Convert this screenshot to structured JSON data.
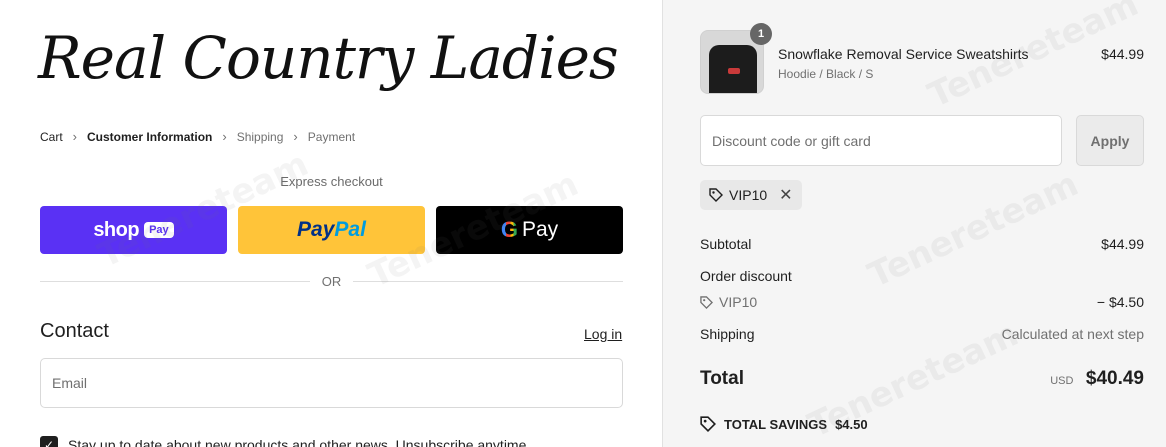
{
  "brand": {
    "logo_text": "Real Country Ladies"
  },
  "breadcrumb": {
    "items": [
      "Cart",
      "Customer Information",
      "Shipping",
      "Payment"
    ],
    "separator": "›"
  },
  "express": {
    "title": "Express checkout",
    "shop_word": "shop",
    "shop_pay": "Pay",
    "paypal_1": "Pay",
    "paypal_2": "Pal",
    "gpay_g": "G",
    "gpay_word": "Pay",
    "or": "OR"
  },
  "contact": {
    "title": "Contact",
    "login": "Log in",
    "email_placeholder": "Email",
    "newsletter": "Stay up to date about new products and other news. Unsubscribe anytime."
  },
  "cart": {
    "item": {
      "quantity": "1",
      "name": "Snowflake Removal Service Sweatshirts",
      "variant": "Hoodie / Black / S",
      "price": "$44.99"
    },
    "discount_placeholder": "Discount code or gift card",
    "apply_label": "Apply",
    "applied_code": "VIP10",
    "subtotal_label": "Subtotal",
    "subtotal_value": "$44.99",
    "order_discount_label": "Order discount",
    "order_discount_code": "VIP10",
    "order_discount_value": "− $4.50",
    "shipping_label": "Shipping",
    "shipping_value": "Calculated at next step",
    "total_label": "Total",
    "currency": "USD",
    "total_value": "$40.49",
    "savings_label": "TOTAL SAVINGS",
    "savings_value": "$4.50"
  },
  "watermark": "Tenereteam",
  "colors": {
    "shop_pay": "#5a31f4",
    "paypal": "#ffc439",
    "gpay": "#000000"
  }
}
